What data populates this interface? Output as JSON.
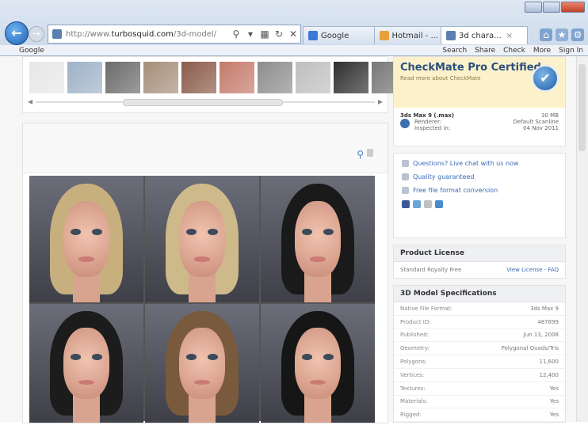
{
  "browser": {
    "address_url_prefix": "http://www.",
    "address_url_domain": "turbosquid.com",
    "address_url_suffix": "/3d-model/",
    "tabs": [
      {
        "label": "Google",
        "color": "#3b78d8"
      },
      {
        "label": "Hotmail - ...",
        "color": "#e8a03a"
      },
      {
        "label": "3d chara...",
        "color": "#5b7fb0"
      }
    ],
    "google_bar": {
      "left_label": "Google",
      "items": [
        "Search",
        "Share",
        "Check",
        "More",
        "Sign In"
      ]
    }
  },
  "gallery": {
    "thumb_colors": [
      "#e7e7e7",
      "#9fb2c8",
      "#6b6b6b",
      "#a58f7a",
      "#8a5b4a",
      "#c47a6a",
      "#8d8d8d",
      "#bfbfbf",
      "#2f2f2f",
      "#787878"
    ]
  },
  "viewer": {
    "faces": [
      {
        "hair": "#c8b07e"
      },
      {
        "hair": "#cdb98a"
      },
      {
        "hair": "#1a1a1a"
      },
      {
        "hair": "#1c1c1c"
      },
      {
        "hair": "#7a5a3c"
      },
      {
        "hair": "#161616"
      }
    ]
  },
  "sidebar": {
    "checkmate": {
      "title": "CheckMate Pro Certified",
      "sub": "Read more about CheckMate",
      "detail_row1_left": "3ds Max 9 (.max)",
      "detail_row1_right": "30 MB",
      "detail_row2_left": "Renderer:",
      "detail_row2_right": "Default Scanline",
      "detail_row3_left": "Inspected in:",
      "detail_row3_right": "04 Nov 2011"
    },
    "links": [
      "Questions? Live chat with us now",
      "Quality guaranteed",
      "Free file format conversion"
    ],
    "social_colors": [
      "#3b5998",
      "#6aa6d8",
      "#c0c0c0",
      "#4a8cc9"
    ],
    "license": {
      "title": "Product License",
      "left": "Standard Royalty Free",
      "right": "View License - FAQ"
    },
    "specs": {
      "title": "3D Model Specifications",
      "rows": [
        {
          "label": "Native File Format:",
          "value": "3ds Max 9"
        },
        {
          "label": "Product ID:",
          "value": "487899"
        },
        {
          "label": "Published:",
          "value": "Jun 13, 2008"
        },
        {
          "label": "Geometry:",
          "value": "Polygonal Quads/Tris"
        },
        {
          "label": "Polygons:",
          "value": "11,600"
        },
        {
          "label": "Vertices:",
          "value": "12,400"
        },
        {
          "label": "Textures:",
          "value": "Yes"
        },
        {
          "label": "Materials:",
          "value": "Yes"
        },
        {
          "label": "Rigged:",
          "value": "Yes"
        }
      ]
    }
  }
}
